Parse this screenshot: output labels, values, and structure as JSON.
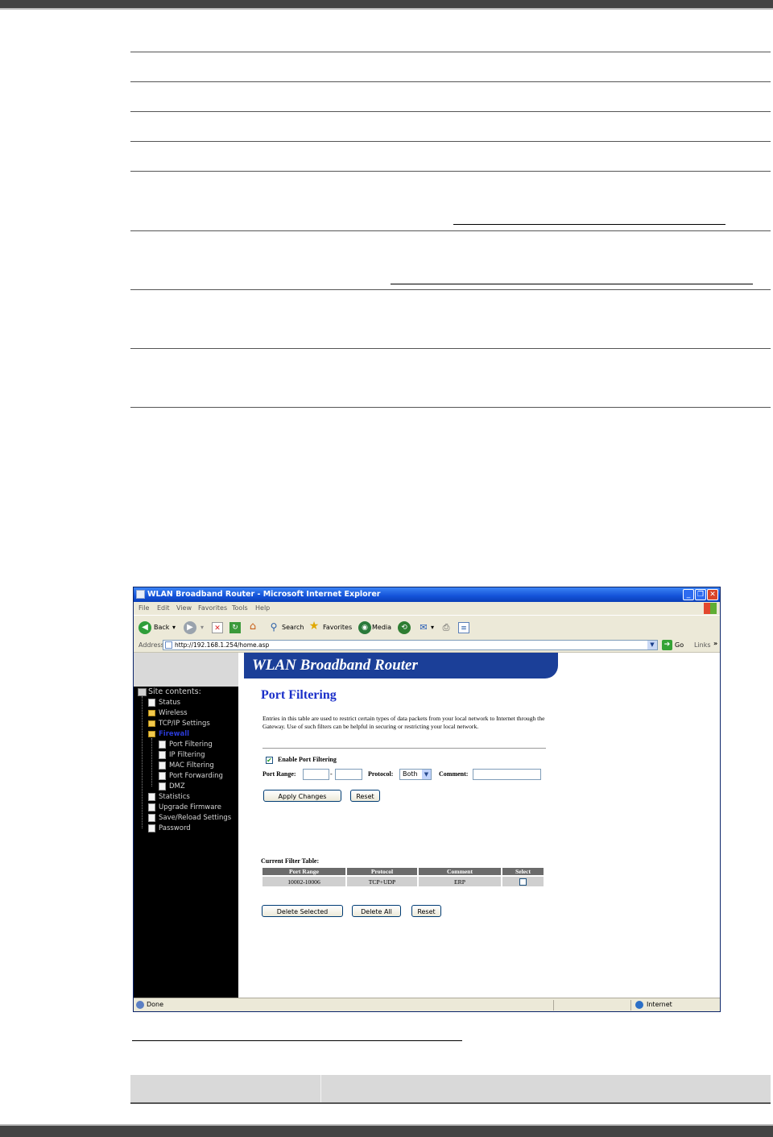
{
  "browser": {
    "window_title": "WLAN Broadband Router - Microsoft Internet Explorer",
    "menu": [
      "File",
      "Edit",
      "View",
      "Favorites",
      "Tools",
      "Help"
    ],
    "toolbar": {
      "back_label": "Back",
      "search_label": "Search",
      "favorites_label": "Favorites",
      "media_label": "Media"
    },
    "address": {
      "label": "Address",
      "url": "http://192.168.1.254/home.asp",
      "go_label": "Go",
      "links_label": "Links"
    },
    "status": {
      "left": "Done",
      "zone": "Internet"
    }
  },
  "router": {
    "banner": "WLAN Broadband Router",
    "sidebar": {
      "root": "Site contents:",
      "items": [
        {
          "label": "Status",
          "type": "page"
        },
        {
          "label": "Wireless",
          "type": "folder"
        },
        {
          "label": "TCP/IP Settings",
          "type": "folder"
        },
        {
          "label": "Firewall",
          "type": "folder"
        },
        {
          "label": "Port Filtering",
          "type": "page"
        },
        {
          "label": "IP Filtering",
          "type": "page"
        },
        {
          "label": "MAC Filtering",
          "type": "page"
        },
        {
          "label": "Port Forwarding",
          "type": "page"
        },
        {
          "label": "DMZ",
          "type": "page"
        },
        {
          "label": "Statistics",
          "type": "page"
        },
        {
          "label": "Upgrade Firmware",
          "type": "page"
        },
        {
          "label": "Save/Reload Settings",
          "type": "page"
        },
        {
          "label": "Password",
          "type": "page"
        }
      ]
    },
    "page": {
      "title": "Port Filtering",
      "description": "Entries in this table are used to restrict certain types of data packets from your local network to Internet through the Gateway. Use of such filters can be helpful in securing or restricting your local network.",
      "enable_label": "Enable Port Filtering",
      "enable_checked": true,
      "port_range_label": "Port Range:",
      "port_range_sep": "-",
      "port_from": "",
      "port_to": "",
      "protocol_label": "Protocol:",
      "protocol_value": "Both",
      "comment_label": "Comment:",
      "comment_value": "",
      "apply_button": "Apply Changes",
      "reset_button": "Reset",
      "table_title": "Current Filter Table:",
      "table_headers": [
        "Port Range",
        "Protocol",
        "Comment",
        "Select"
      ],
      "table_rows": [
        {
          "port_range": "10002-10006",
          "protocol": "TCP+UDP",
          "comment": "ERP",
          "selected": false
        }
      ],
      "delete_selected_button": "Delete Selected",
      "delete_all_button": "Delete All",
      "reset_bottom_button": "Reset"
    }
  }
}
